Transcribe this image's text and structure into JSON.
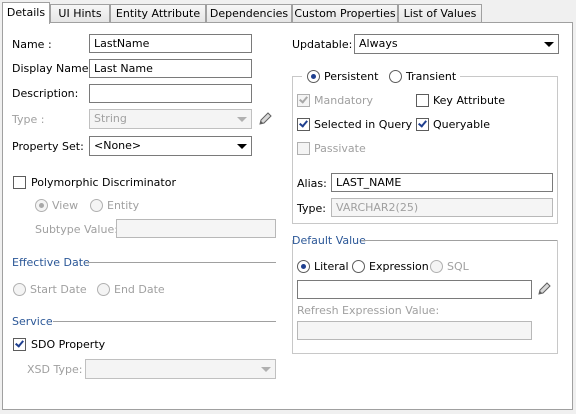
{
  "tabs": [
    {
      "label": "Details",
      "active": true
    },
    {
      "label": "UI Hints"
    },
    {
      "label": "Entity Attribute"
    },
    {
      "label": "Dependencies"
    },
    {
      "label": "Custom Properties"
    },
    {
      "label": "List of Values"
    }
  ],
  "left": {
    "name_label": "Name :",
    "name_value": "LastName",
    "display_name_label": "Display Name:",
    "display_name_value": "Last Name",
    "description_label": "Description:",
    "description_value": "",
    "type_label": "Type :",
    "type_value": "String",
    "property_set_label": "Property Set:",
    "property_set_value": "<None>",
    "polymorphic_label": "Polymorphic Discriminator",
    "polymorphic_checked": false,
    "view_label": "View",
    "entity_label": "Entity",
    "subtype_label": "Subtype Value:",
    "subtype_value": "",
    "effective_date_section": "Effective Date",
    "start_date_label": "Start Date",
    "end_date_label": "End Date",
    "service_section": "Service",
    "sdo_label": "SDO Property",
    "sdo_checked": true,
    "xsd_label": "XSD Type:",
    "xsd_value": ""
  },
  "right": {
    "updatable_label": "Updatable:",
    "updatable_value": "Always",
    "persistent_label": "Persistent",
    "transient_label": "Transient",
    "mandatory_label": "Mandatory",
    "mandatory_checked": true,
    "key_attribute_label": "Key Attribute",
    "key_attribute_checked": false,
    "selected_in_query_label": "Selected in Query",
    "selected_in_query_checked": true,
    "queryable_label": "Queryable",
    "queryable_checked": true,
    "passivate_label": "Passivate",
    "passivate_checked": false,
    "alias_label": "Alias:",
    "alias_value": "LAST_NAME",
    "type_label": "Type:",
    "type_value": "VARCHAR2(25)",
    "default_value_section": "Default Value",
    "literal_label": "Literal",
    "expression_label": "Expression",
    "sql_label": "SQL",
    "default_value": "",
    "refresh_label": "Refresh Expression Value:",
    "refresh_value": ""
  },
  "colors": {
    "section_text": "#2b5797",
    "check_mark": "#1f3f8f",
    "disabled_text": "#a0a0a0"
  }
}
